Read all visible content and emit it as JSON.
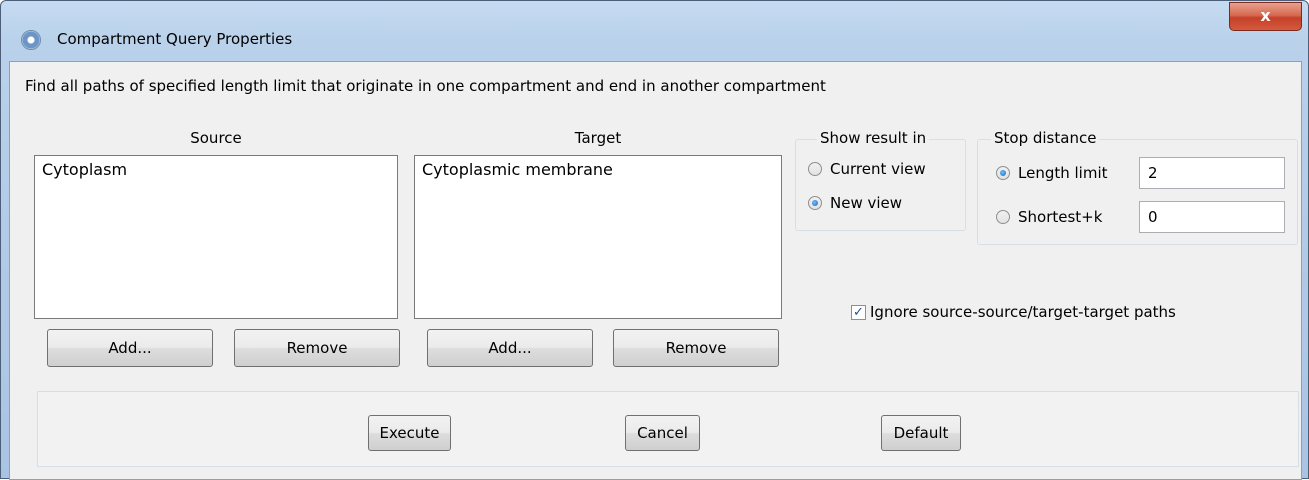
{
  "window": {
    "title": "Compartment Query Properties",
    "close_glyph": "x",
    "icon": "app-icon"
  },
  "description": "Find all paths of specified length limit that originate in one compartment and end in another compartment",
  "source": {
    "label": "Source",
    "items": [
      "Cytoplasm"
    ],
    "add_label": "Add...",
    "remove_label": "Remove"
  },
  "target": {
    "label": "Target",
    "items": [
      "Cytoplasmic membrane"
    ],
    "add_label": "Add...",
    "remove_label": "Remove"
  },
  "show_result": {
    "legend": "Show result in",
    "options": [
      {
        "label": "Current view",
        "selected": false
      },
      {
        "label": "New view",
        "selected": true
      }
    ]
  },
  "stop_distance": {
    "legend": "Stop distance",
    "length_limit": {
      "label": "Length limit",
      "selected": true,
      "value": "2"
    },
    "shortest_k": {
      "label": "Shortest+k",
      "selected": false,
      "value": "0"
    }
  },
  "ignore_paths": {
    "label": "Ignore source-source/target-target paths",
    "checked": true,
    "check_glyph": "✓"
  },
  "actions": {
    "execute_label": "Execute",
    "cancel_label": "Cancel",
    "default_label": "Default"
  },
  "colors": {
    "title_bar": "#b9d1ea",
    "close_button": "#c4402a",
    "dialog_bg": "#f0f0f0"
  }
}
